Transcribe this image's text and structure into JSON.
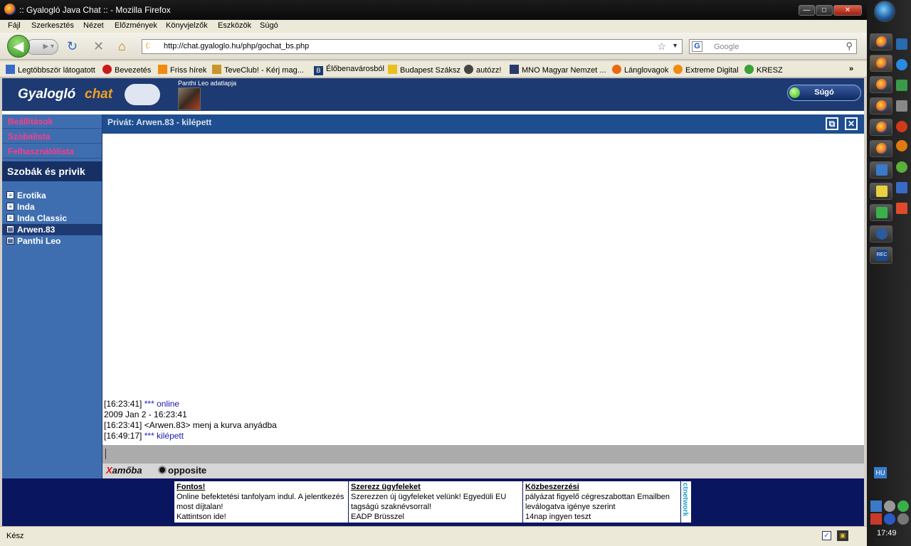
{
  "window": {
    "title": ":: Gyalogló Java Chat :: - Mozilla Firefox",
    "min": "—",
    "max": "□",
    "close": "✕"
  },
  "menu": [
    "Fájl",
    "Szerkesztés",
    "Nézet",
    "Előzmények",
    "Könyvjelzők",
    "Eszközök",
    "Súgó"
  ],
  "nav": {
    "url": "http://chat.gyaloglo.hu/php/gochat_bs.php",
    "search_placeholder": "Google",
    "search_engine": "G"
  },
  "bookmarks": [
    "Legtöbbször látogatott",
    "Bevezetés",
    "Friss hírek",
    "TeveClub! - Kérj mag...",
    "Élőbenavárosból",
    "Budapest Száksz",
    "autózz!",
    "MNO Magyar Nemzet ...",
    "Lánglovagok",
    "Extreme Digital",
    "KRESZ"
  ],
  "bookmarks_more": "»",
  "header": {
    "logo_part1": "Gyalogló",
    "logo_part2": "chat",
    "profile_label": "Panthi Leo adatlapja",
    "help": "Súgó"
  },
  "sidebar": {
    "links": [
      "Beállítások",
      "Szobalista",
      "Felhasználólista"
    ],
    "rooms_title": "Szobák és privik",
    "rooms": [
      "Erotika",
      "Inda",
      "Inda Classic",
      "Arwen.83",
      "Panthi Leo"
    ],
    "selected_room": "Arwen.83"
  },
  "chat": {
    "title": "Privát: Arwen.83 - kilépett",
    "messages": [
      {
        "time": "[16:23:41]",
        "text": "*** online",
        "system": true
      },
      {
        "time": "",
        "text": "2009 Jan 2 - 16:23:41",
        "system": false
      },
      {
        "time": "[16:23:41]",
        "text": "<Arwen.83> menj a kurva anyádba",
        "system": false
      },
      {
        "time": "[16:49:17]",
        "text": "*** kilépett",
        "system": true
      }
    ]
  },
  "games": {
    "amoba_x": "X",
    "amoba": "amőba",
    "opposite": "opposite"
  },
  "ads": [
    {
      "title": "Fontos!",
      "l1": "Online befektetési tanfolyam indul. A jelentkezés",
      "l2": "most díjtalan!",
      "l3": "Kattintson ide!"
    },
    {
      "title": "Szerezz ügyfeleket",
      "l1": "Szerezzen új ügyfeleket velünk! Egyedüli EU",
      "l2": "tagságú szaknévsorral!",
      "l3": "EADP Brüsszel"
    },
    {
      "title": "Közbeszerzési",
      "l1": "pályázat figyelő cégreszabottan Emailben",
      "l2": "leválogatva igénye szerint",
      "l3": "14nap ingyen teszt"
    }
  ],
  "ad_network": "ctnetwork",
  "status": "Kész",
  "taskbar": {
    "lang": "HU",
    "clock": "17:49"
  },
  "colors": {
    "header_bg": "#1e3a72",
    "sidebar_bg": "#3f6eb0",
    "link_pink": "#ff3b8a",
    "system_msg": "#1a1ab0"
  }
}
